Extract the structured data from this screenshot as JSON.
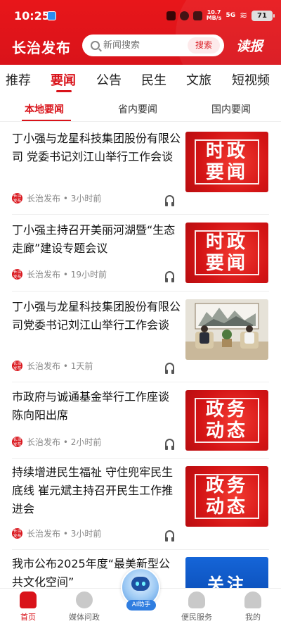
{
  "status_bar": {
    "time": "10:25",
    "net_speed": "10.7\nMB/s",
    "signal": "5G",
    "battery": "71"
  },
  "header": {
    "brand": "长治发布",
    "search_placeholder": "新闻搜索",
    "search_button": "搜索",
    "read_label": "读报"
  },
  "channels": [
    {
      "label": "推荐",
      "active": false
    },
    {
      "label": "要闻",
      "active": true
    },
    {
      "label": "公告",
      "active": false
    },
    {
      "label": "民生",
      "active": false
    },
    {
      "label": "文旅",
      "active": false
    },
    {
      "label": "短视频",
      "active": false
    }
  ],
  "subtabs": [
    {
      "label": "本地要闻",
      "active": true
    },
    {
      "label": "省内要闻",
      "active": false
    },
    {
      "label": "国内要闻",
      "active": false
    }
  ],
  "news": [
    {
      "title": "丁小强与龙星科技集团股份有限公司 党委书记刘江山举行工作会谈",
      "source": "长治发布",
      "time": "3小时前",
      "thumb_lines": [
        "时政",
        "要闻"
      ]
    },
    {
      "title": "丁小强主持召开美丽河湖暨“生态走廊”建设专题会议",
      "source": "长治发布",
      "time": "19小时前",
      "thumb_lines": [
        "时政",
        "要闻"
      ]
    },
    {
      "title": "丁小强与龙星科技集团股份有限公司党委书记刘江山举行工作会谈",
      "source": "长治发布",
      "time": "1天前",
      "thumb_lines": []
    },
    {
      "title": "市政府与诚通基金举行工作座谈 陈向阳出席",
      "source": "长治发布",
      "time": "2小时前",
      "thumb_lines": [
        "政务",
        "动态"
      ]
    },
    {
      "title": "持续增进民生福祉 守住兜牢民生底线  崔元斌主持召开民生工作推进会",
      "source": "长治发布",
      "time": "3小时前",
      "thumb_lines": [
        "政务",
        "动态"
      ]
    },
    {
      "title": "我市公布2025年度“最美新型公共文化空间”",
      "source": "",
      "time": "",
      "thumb_lines": [
        "关注"
      ]
    }
  ],
  "source_logo_text": "长治\n发布",
  "bottom_nav": [
    {
      "label": "首页",
      "icon": "home-icon",
      "active": true
    },
    {
      "label": "媒体问政",
      "icon": "planet-icon",
      "active": false
    },
    {
      "label": "便民服务",
      "icon": "heart-hand-icon",
      "active": false
    },
    {
      "label": "我的",
      "icon": "user-icon",
      "active": false
    }
  ],
  "ai_button": {
    "label": "AI助手",
    "icon": "robot-icon"
  },
  "colors": {
    "brand_red": "#d9131a",
    "text": "#111111",
    "meta": "#888888"
  }
}
